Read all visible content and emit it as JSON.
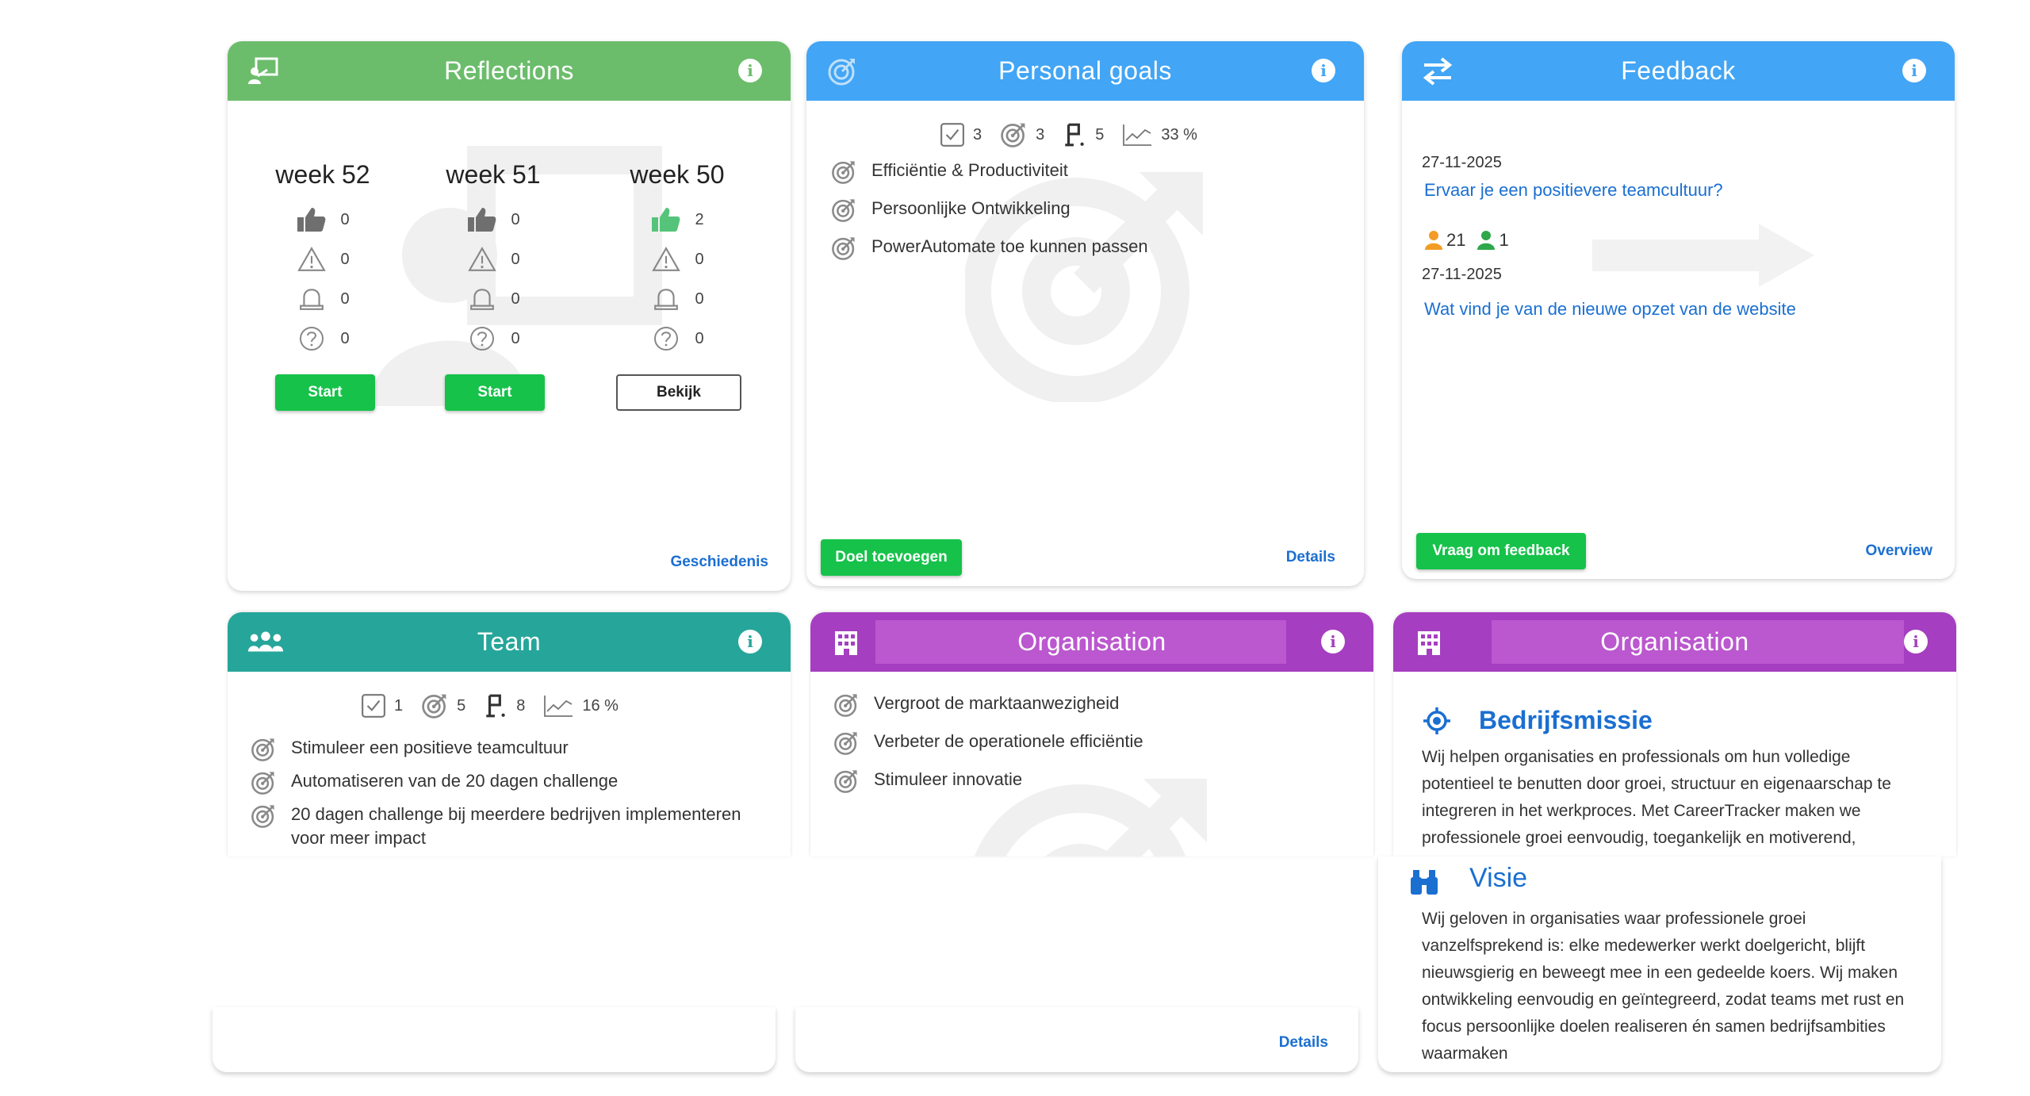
{
  "colors": {
    "reflections": "#6bbd6b",
    "goals": "#42a5f5",
    "feedback": "#42a5f5",
    "team": "#26a69a",
    "organisation": "#a53ec0",
    "organisation_band": "#bb57cf",
    "link": "#1a6fd1",
    "button": "#16c24a"
  },
  "reflections": {
    "title": "Reflections",
    "icon": "presentation-icon",
    "weeks": [
      {
        "label": "week 52",
        "likes": "0",
        "warnings": "0",
        "bells": "0",
        "questions": "0",
        "button": "Start",
        "button_style": "filled"
      },
      {
        "label": "week 51",
        "likes": "0",
        "warnings": "0",
        "bells": "0",
        "questions": "0",
        "button": "Start",
        "button_style": "filled"
      },
      {
        "label": "week 50",
        "likes": "2",
        "warnings": "0",
        "bells": "0",
        "questions": "0",
        "button": "Bekijk",
        "button_style": "outline"
      }
    ],
    "history_link": "Geschiedenis"
  },
  "goals": {
    "title": "Personal goals",
    "stats": {
      "done": "3",
      "goals": "3",
      "milestones": "5",
      "progress": "33 %"
    },
    "items": [
      "Efficiëntie & Productiviteit",
      "Persoonlijke Ontwikkeling",
      "PowerAutomate toe kunnen passen"
    ],
    "add_button": "Doel toevoegen",
    "details_link": "Details"
  },
  "feedback": {
    "title": "Feedback",
    "entries": [
      {
        "date": "27-11-2025",
        "question": "Ervaar je een positievere teamcultuur?",
        "count_orange": "21",
        "count_green": "1"
      },
      {
        "date": "27-11-2025",
        "question": "Wat vind je van de nieuwe opzet van de website"
      }
    ],
    "ask_button": "Vraag om feedback",
    "overview_link": "Overview"
  },
  "team": {
    "title": "Team",
    "stats": {
      "done": "1",
      "goals": "5",
      "milestones": "8",
      "progress": "16 %"
    },
    "items": [
      "Stimuleer een positieve teamcultuur",
      "Automatiseren van de 20 dagen challenge",
      "20 dagen challenge bij meerdere bedrijven implementeren voor meer impact"
    ]
  },
  "organisation_goals": {
    "title": "Organisation",
    "items": [
      "Vergroot de marktaanwezigheid",
      "Verbeter de operationele efficiëntie",
      "Stimuleer innovatie"
    ],
    "details_link": "Details"
  },
  "organisation_mission": {
    "title": "Organisation",
    "mission_title": "Bedrijfsmissie",
    "mission_text": "Wij helpen organisaties en professionals om hun volledige potentieel te benutten door groei, structuur en eigenaarschap te integreren in het werkproces. Met CareerTracker maken we professionele groei eenvoudig, toegankelijk en motiverend,",
    "vision_title": "Visie",
    "vision_text": "Wij geloven in organisaties waar professionele groei vanzelfsprekend is: elke medewerker werkt doelgericht, blijft nieuwsgierig en beweegt mee in een gedeelde koers. Wij maken ontwikkeling eenvoudig en geïntegreerd, zodat teams met rust en focus persoonlijke doelen realiseren én samen bedrijfsambities waarmaken"
  }
}
